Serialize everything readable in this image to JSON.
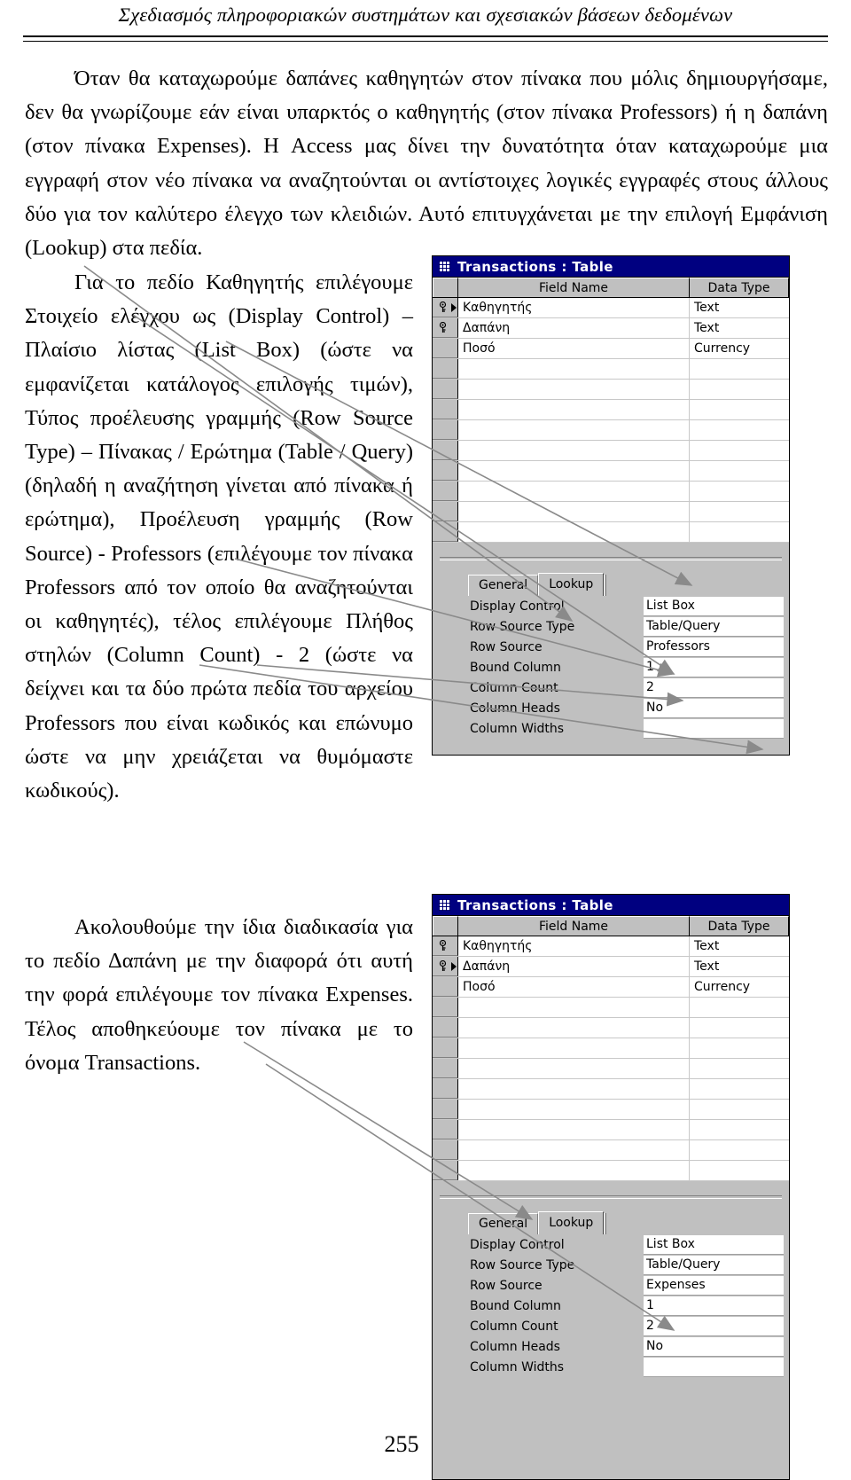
{
  "header": {
    "running_title": "Σχεδιασμός πληροφοριακών συστημάτων και σχεσιακών βάσεων δεδομένων"
  },
  "body": {
    "paragraph_1": "Όταν θα καταχωρούμε δαπάνες καθηγητών στον πίνακα που μόλις δημιουργήσαμε, δεν θα γνωρίζουμε εάν είναι υπαρκτός ο καθηγητής (στον πίνακα Professors) ή η δαπάνη (στον πίνακα Expenses). Η Access μας δίνει την δυνατότητα όταν καταχωρούμε μια εγγραφή στον νέο πίνακα να αναζητούνται οι αντίστοιχες λογικές εγγραφές στους άλλους δύο για τον καλύτερο έλεγχο των κλειδιών. Αυτό επιτυγχάνεται με την επιλογή Εμφάνιση (Lookup) στα πεδία.",
    "paragraph_2": "Για το πεδίο Καθηγητής επιλέγουμε Στοιχείο ελέγχου ως (Display Control) – Πλαίσιο λίστας (List Box) (ώστε να εμφανίζεται κατάλογος επιλογής τιμών), Τύπος προέλευσης γραμμής (Row Source Type) – Πίνακας / Ερώτημα (Table / Query) (δηλαδή η αναζήτηση γίνεται από πίνακα ή ερώτημα), Προέλευση γραμμής (Row Source) - Professors (επιλέγουμε τον πίνακα Professors από τον οποίο θα αναζητούνται οι καθηγητές), τέλος επιλέγουμε Πλήθος στηλών (Column Count) - 2 (ώστε να δείχνει και τα δύο πρώτα πεδία του αρχείου Professors που είναι κωδικός και επώνυμο ώστε να μην χρειάζεται να θυμόμαστε κωδικούς).",
    "paragraph_3": "Ακολουθούμε την ίδια διαδικασία για το πεδίο Δαπάνη με την διαφορά ότι αυτή την φορά επιλέγουμε τον πίνακα Expenses. Τέλος αποθηκεύουμε τον πίνακα με το όνομα Transactions.",
    "page_number": "255"
  },
  "screenshot_1": {
    "window_title": "Transactions : Table",
    "grid": {
      "columns": [
        "Field Name",
        "Data Type"
      ],
      "rows": [
        {
          "key": true,
          "current": true,
          "field_name": "Καθηγητής",
          "data_type": "Text"
        },
        {
          "key": true,
          "current": false,
          "field_name": "Δαπάνη",
          "data_type": "Text"
        },
        {
          "key": false,
          "current": false,
          "field_name": "Ποσό",
          "data_type": "Currency"
        }
      ],
      "blank_rows": 9
    },
    "properties": {
      "tabs": [
        {
          "label": "General",
          "active": false
        },
        {
          "label": "Lookup",
          "active": true
        }
      ],
      "rows": [
        {
          "label": "Display Control",
          "value": "List Box"
        },
        {
          "label": "Row Source Type",
          "value": "Table/Query"
        },
        {
          "label": "Row Source",
          "value": "Professors"
        },
        {
          "label": "Bound Column",
          "value": "1"
        },
        {
          "label": "Column Count",
          "value": "2"
        },
        {
          "label": "Column Heads",
          "value": "No"
        },
        {
          "label": "Column Widths",
          "value": ""
        }
      ]
    }
  },
  "screenshot_2": {
    "window_title": "Transactions : Table",
    "grid": {
      "columns": [
        "Field Name",
        "Data Type"
      ],
      "rows": [
        {
          "key": true,
          "current": false,
          "field_name": "Καθηγητής",
          "data_type": "Text"
        },
        {
          "key": true,
          "current": true,
          "field_name": "Δαπάνη",
          "data_type": "Text"
        },
        {
          "key": false,
          "current": false,
          "field_name": "Ποσό",
          "data_type": "Currency"
        }
      ],
      "blank_rows": 9
    },
    "properties": {
      "tabs": [
        {
          "label": "General",
          "active": false
        },
        {
          "label": "Lookup",
          "active": true
        }
      ],
      "rows": [
        {
          "label": "Display Control",
          "value": "List Box"
        },
        {
          "label": "Row Source Type",
          "value": "Table/Query"
        },
        {
          "label": "Row Source",
          "value": "Expenses"
        },
        {
          "label": "Bound Column",
          "value": "1"
        },
        {
          "label": "Column Count",
          "value": "2"
        },
        {
          "label": "Column Heads",
          "value": "No"
        },
        {
          "label": "Column Widths",
          "value": ""
        }
      ]
    }
  },
  "colors": {
    "titlebar": "#000080",
    "chrome": "#c0c0c0",
    "field_bg": "#ffffff",
    "leader_line": "#808080"
  }
}
